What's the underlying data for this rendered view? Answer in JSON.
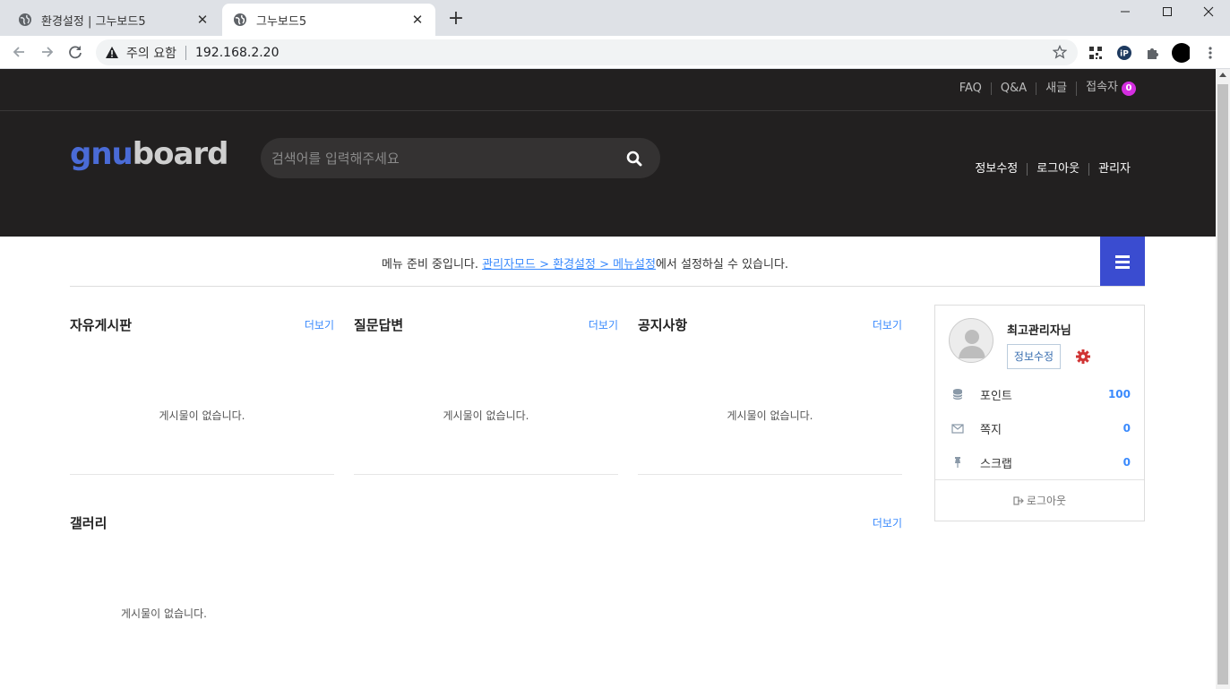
{
  "browser": {
    "tabs": [
      {
        "title": "환경설정 | 그누보드5",
        "active": false
      },
      {
        "title": "그누보드5",
        "active": true
      }
    ],
    "new_tab": "+",
    "security_label": "주의 요함",
    "url": "192.168.2.20"
  },
  "site": {
    "top_links": [
      "FAQ",
      "Q&A",
      "새글",
      "접속자"
    ],
    "visitor_count": "0",
    "logo": {
      "part1": "gnu",
      "part2": "board"
    },
    "search_placeholder": "검색어를 입력해주세요",
    "header_links": [
      "정보수정",
      "로그아웃",
      "관리자"
    ],
    "menu_notice": {
      "prefix": "메뉴 준비 중입니다. ",
      "link": "관리자모드 > 환경설정 > 메뉴설정",
      "suffix": "에서 설정하실 수 있습니다."
    },
    "boards": [
      {
        "title": "자유게시판",
        "more": "더보기",
        "empty": "게시물이 없습니다."
      },
      {
        "title": "질문답변",
        "more": "더보기",
        "empty": "게시물이 없습니다."
      },
      {
        "title": "공지사항",
        "more": "더보기",
        "empty": "게시물이 없습니다."
      },
      {
        "title": "갤러리",
        "more": "더보기",
        "empty": "게시물이 없습니다."
      }
    ],
    "profile": {
      "name": "최고관리자님",
      "edit_button": "정보수정",
      "rows": [
        {
          "label": "포인트",
          "value": "100",
          "icon": "database-icon"
        },
        {
          "label": "쪽지",
          "value": "0",
          "icon": "envelope-icon"
        },
        {
          "label": "스크랩",
          "value": "0",
          "icon": "thumbtack-icon"
        }
      ],
      "logout": "로그아웃"
    },
    "colors": {
      "header_bg": "#222020",
      "accent": "#3a4cd0",
      "link": "#3a8afd",
      "badge": "#d42ee0"
    }
  }
}
